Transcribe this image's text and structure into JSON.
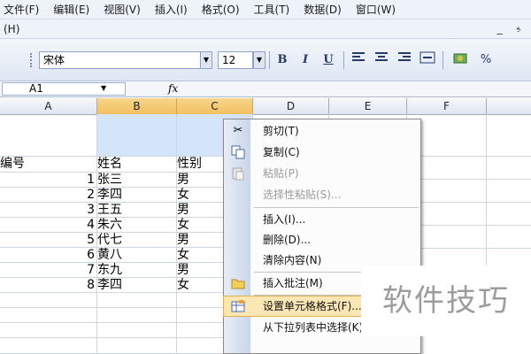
{
  "menubar": {
    "items": [
      "文件(F)",
      "编辑(E)",
      "视图(V)",
      "插入(I)",
      "格式(O)",
      "工具(T)",
      "数据(D)",
      "窗口(W)"
    ],
    "help": "(H)",
    "window_controls": "_ 𝔰"
  },
  "toolbar": {
    "font_name": "宋体",
    "font_size": "12",
    "bold": "B",
    "italic": "I",
    "underline": "U",
    "percent": "%"
  },
  "formula_bar": {
    "cell_ref": "A1",
    "fx": "fx"
  },
  "columns": [
    "A",
    "B",
    "C",
    "D",
    "E",
    "F"
  ],
  "sheet": {
    "header": {
      "a": "编号",
      "b": "姓名",
      "c": "性别"
    },
    "rows": [
      {
        "a": "1",
        "b": "张三",
        "c": "男"
      },
      {
        "a": "2",
        "b": "李四",
        "c": "女"
      },
      {
        "a": "3",
        "b": "王五",
        "c": "男"
      },
      {
        "a": "4",
        "b": "朱六",
        "c": "女"
      },
      {
        "a": "5",
        "b": "代七",
        "c": "男"
      },
      {
        "a": "6",
        "b": "黄八",
        "c": "女"
      },
      {
        "a": "7",
        "b": "东九",
        "c": "男"
      },
      {
        "a": "8",
        "b": "李四",
        "c": "女"
      }
    ]
  },
  "context_menu": {
    "items": [
      {
        "label": "剪切(T)",
        "icon": "scissors-icon",
        "enabled": true
      },
      {
        "label": "复制(C)",
        "icon": "copy-icon",
        "enabled": true
      },
      {
        "label": "粘贴(P)",
        "icon": "paste-icon",
        "enabled": false
      },
      {
        "label": "选择性粘贴(S)...",
        "icon": "",
        "enabled": false
      },
      {
        "label": "插入(I)...",
        "icon": "",
        "enabled": true
      },
      {
        "label": "删除(D)...",
        "icon": "",
        "enabled": true
      },
      {
        "label": "清除内容(N)",
        "icon": "",
        "enabled": true
      },
      {
        "label": "插入批注(M)",
        "icon": "comment-icon",
        "enabled": true
      },
      {
        "label": "设置单元格格式(F)...",
        "icon": "format-cells-icon",
        "enabled": true
      },
      {
        "label": "从下拉列表中选择(K)...",
        "icon": "",
        "enabled": true
      }
    ]
  },
  "watermark": "软件技巧",
  "colors": {
    "selection": "#d4e4fb",
    "header_selected": "#f2bf5d",
    "menu_highlight": "#fbe7b4"
  }
}
